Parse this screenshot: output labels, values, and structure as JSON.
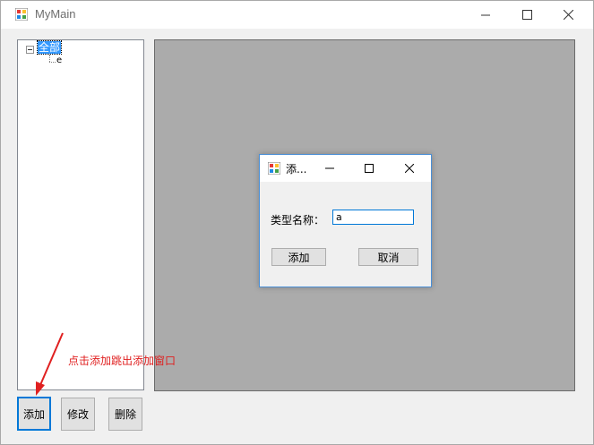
{
  "window": {
    "title": "MyMain"
  },
  "tree": {
    "root_label": "全部",
    "children": [
      "e"
    ]
  },
  "dialog": {
    "title": "添...",
    "field_label": "类型名称：",
    "field_value": "a",
    "add_label": "添加",
    "cancel_label": "取消"
  },
  "buttons": {
    "add_label": "添加",
    "edit_label": "修改",
    "delete_label": "删除"
  },
  "annotation": {
    "text": "点击添加跳出添加窗口",
    "color": "#e02020"
  },
  "colors": {
    "selection": "#3399ff",
    "mdi_background": "#ababab",
    "accent": "#0078d7"
  }
}
